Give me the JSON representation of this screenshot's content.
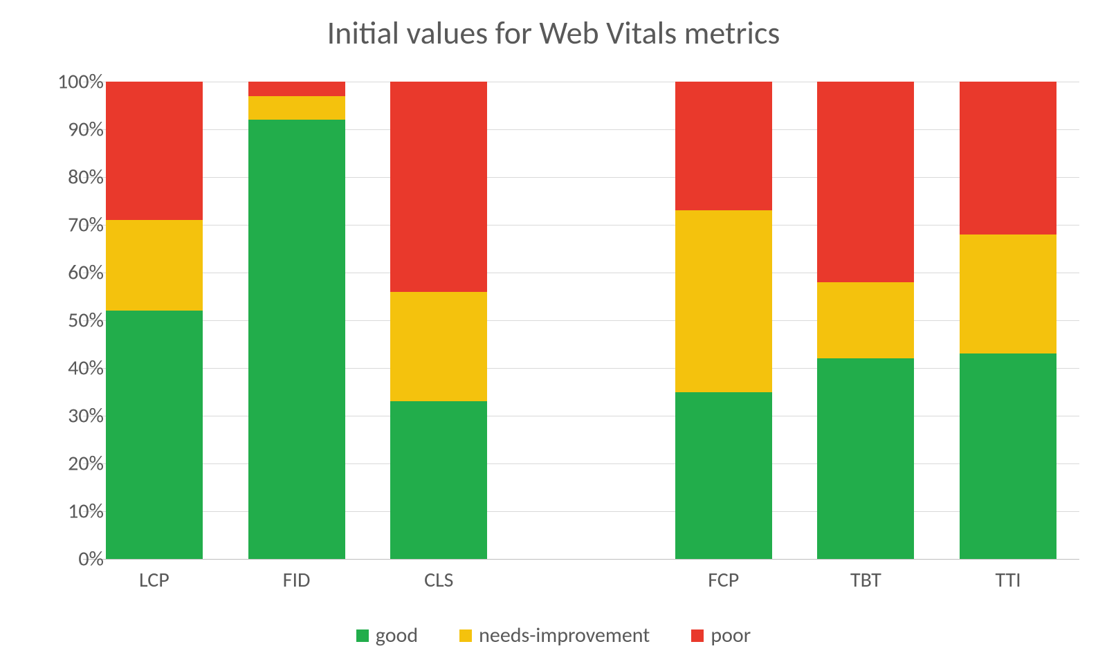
{
  "chart_data": {
    "type": "bar",
    "stacked": true,
    "title": "Initial values for Web Vitals metrics",
    "xlabel": "",
    "ylabel": "",
    "ylim": [
      0,
      100
    ],
    "y_ticks": [
      0,
      10,
      20,
      30,
      40,
      50,
      60,
      70,
      80,
      90,
      100
    ],
    "y_tick_suffix": "%",
    "categories": [
      "LCP",
      "FID",
      "CLS",
      "",
      "FCP",
      "TBT",
      "TTI"
    ],
    "series": [
      {
        "name": "good",
        "color": "#22ad4b",
        "values": [
          52,
          92,
          33,
          null,
          35,
          42,
          43
        ]
      },
      {
        "name": "needs-improvement",
        "color": "#f4c20d",
        "values": [
          19,
          5,
          23,
          null,
          38,
          16,
          25
        ]
      },
      {
        "name": "poor",
        "color": "#e9392c",
        "values": [
          29,
          3,
          44,
          null,
          27,
          42,
          32
        ]
      }
    ],
    "legend_position": "bottom"
  }
}
